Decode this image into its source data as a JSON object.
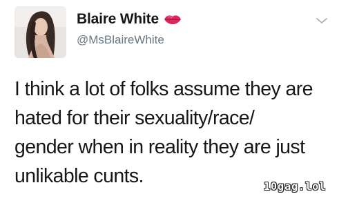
{
  "tweet": {
    "user": {
      "display_name": "Blaire White",
      "handle": "@MsBlaireWhite",
      "name_badge_icon": "lips-icon",
      "avatar": "avatar"
    },
    "menu_icon": "chevron-down-icon",
    "text": "I think a lot of folks assume they are\nhated for their sexuality/race/\ngender when in reality they are just\nunlikable cunts."
  },
  "watermark": "10gag.lol",
  "colors": {
    "name_text": "#14171a",
    "handle_text": "#657786",
    "lips": "#e0245e",
    "chevron": "#aab8c2",
    "background": "#ffffff"
  }
}
